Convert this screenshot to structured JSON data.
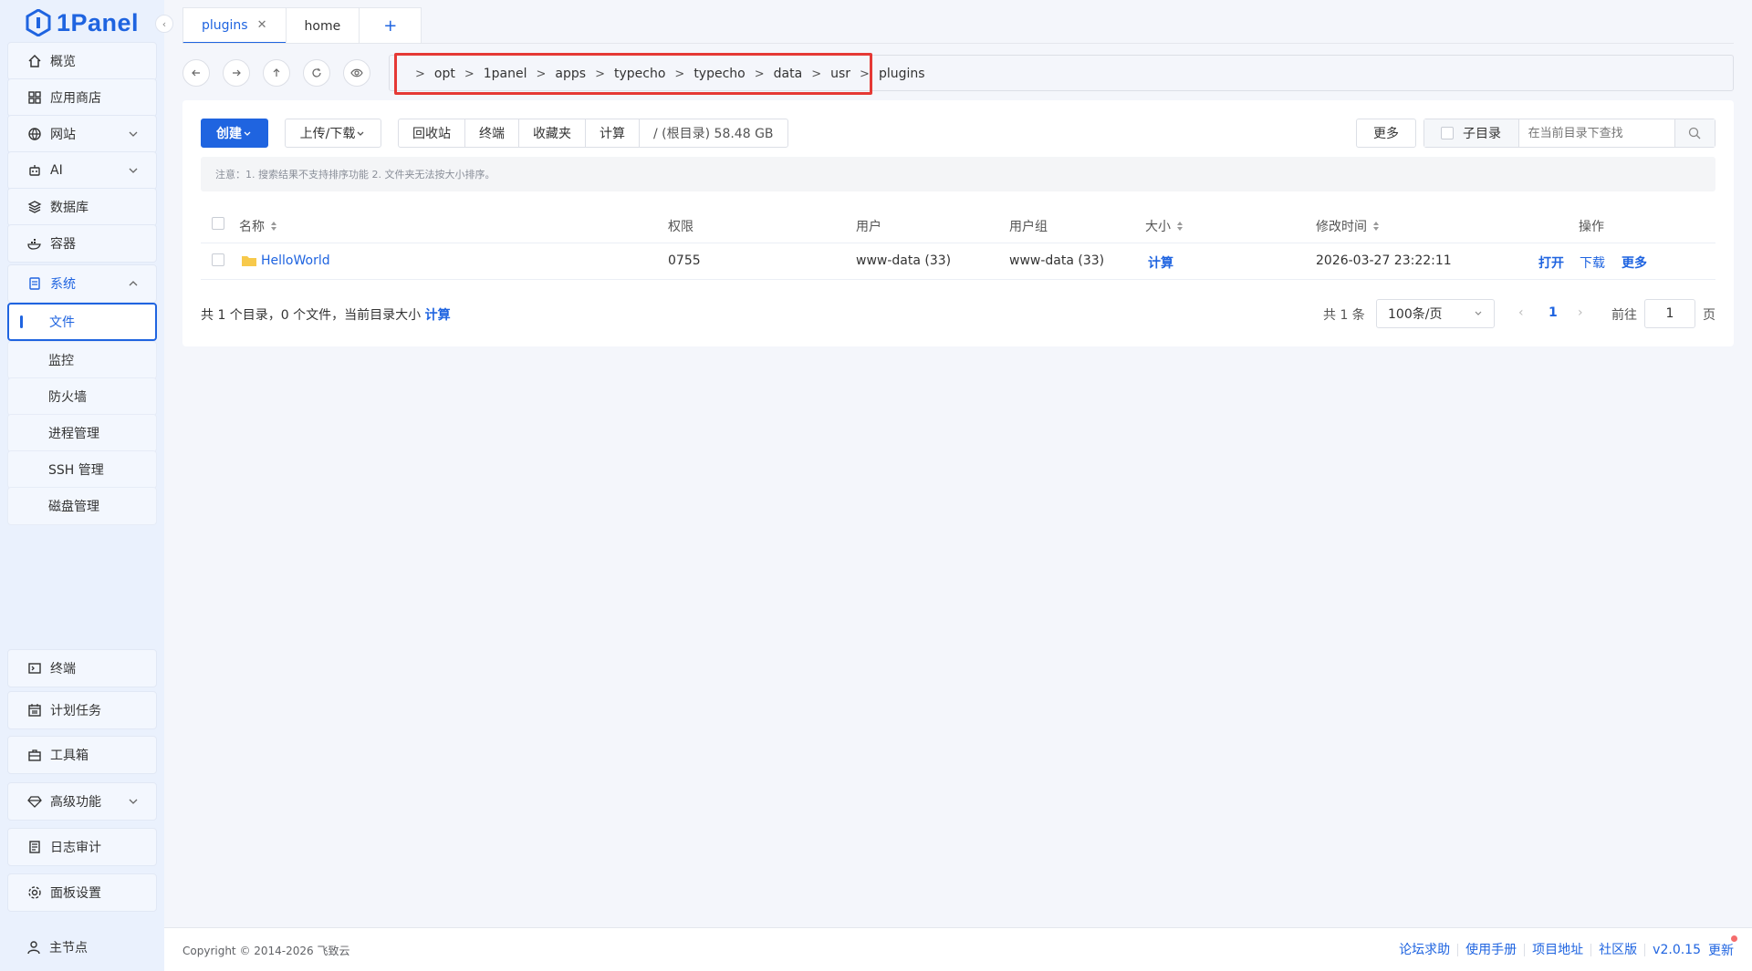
{
  "app": {
    "logo_text": "1Panel"
  },
  "sidebar": {
    "items": [
      {
        "label": "概览",
        "icon": "home-icon"
      },
      {
        "label": "应用商店",
        "icon": "grid-icon"
      },
      {
        "label": "网站",
        "icon": "globe-icon"
      },
      {
        "label": "AI",
        "icon": "robot-icon"
      },
      {
        "label": "数据库",
        "icon": "layers-icon"
      },
      {
        "label": "容器",
        "icon": "docker-icon"
      },
      {
        "label": "系统",
        "icon": "system-icon"
      }
    ],
    "system_sub": [
      "文件",
      "监控",
      "防火墙",
      "进程管理",
      "SSH 管理",
      "磁盘管理"
    ],
    "bottom_items": [
      {
        "label": "终端",
        "icon": "terminal-icon"
      },
      {
        "label": "计划任务",
        "icon": "calendar-icon"
      },
      {
        "label": "工具箱",
        "icon": "toolbox-icon"
      },
      {
        "label": "高级功能",
        "icon": "diamond-icon"
      },
      {
        "label": "日志审计",
        "icon": "log-icon"
      },
      {
        "label": "面板设置",
        "icon": "gear-icon"
      }
    ],
    "node": "主节点"
  },
  "tabs": [
    {
      "label": "plugins",
      "active": true
    },
    {
      "label": "home",
      "active": false
    }
  ],
  "path": [
    "opt",
    "1panel",
    "apps",
    "typecho",
    "typecho",
    "data",
    "usr",
    "plugins"
  ],
  "toolbar": {
    "create": "创建",
    "upload": "上传/下载",
    "group": [
      "回收站",
      "终端",
      "收藏夹",
      "计算",
      "/ (根目录) 58.48 GB"
    ],
    "more": "更多",
    "subdir": "子目录",
    "search_placeholder": "在当前目录下查找"
  },
  "notice": "注意：1. 搜索结果不支持排序功能 2. 文件夹无法按大小排序。",
  "table": {
    "headers": {
      "name": "名称",
      "perm": "权限",
      "user": "用户",
      "group": "用户组",
      "size": "大小",
      "mtime": "修改时间",
      "ops": "操作"
    },
    "rows": [
      {
        "name": "HelloWorld",
        "perm": "0755",
        "user": "www-data (33)",
        "group": "www-data (33)",
        "size": "计算",
        "mtime": "2026-03-27 23:22:11",
        "op_open": "打开",
        "op_download": "下载",
        "op_more": "更多"
      }
    ]
  },
  "summary": {
    "text": "共 1 个目录，0 个文件，当前目录大小",
    "calc": "计算"
  },
  "pagination": {
    "total": "共 1 条",
    "page_size": "100条/页",
    "current": "1",
    "goto": "前往",
    "page_input": "1",
    "page_unit": "页"
  },
  "footer": {
    "copyright": "Copyright © 2014-2026 飞致云",
    "links": [
      "论坛求助",
      "使用手册",
      "项目地址",
      "社区版"
    ],
    "version": "v2.0.15",
    "update": "更新"
  },
  "colors": {
    "accent": "#1f64e0",
    "highlight_box": "#e53935",
    "folder": "#f7c94b"
  }
}
